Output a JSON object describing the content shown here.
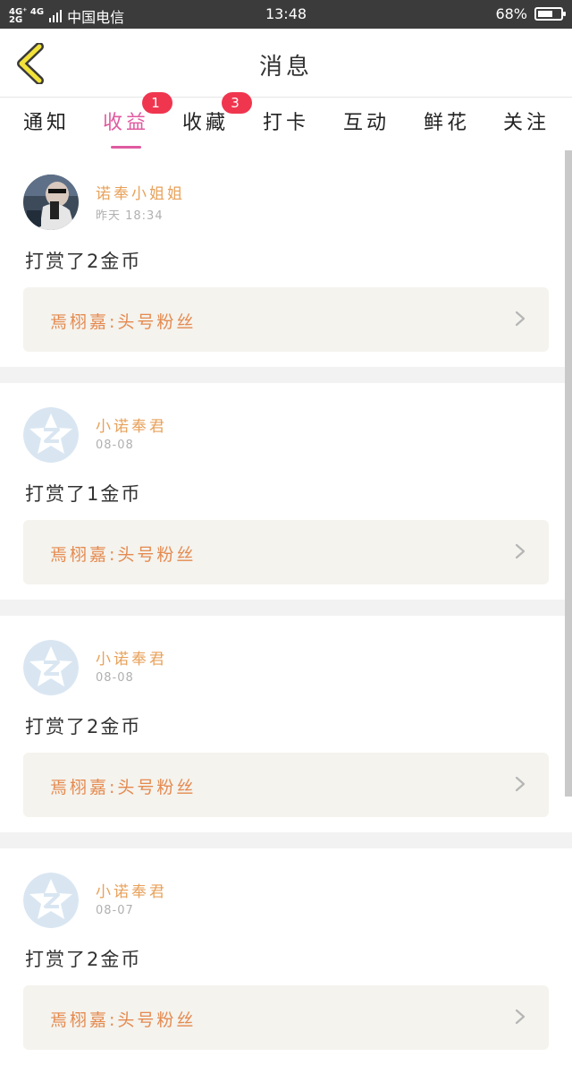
{
  "status_bar": {
    "network_top": "4G⁺ 4G",
    "network_bottom": "2G",
    "carrier": "中国电信",
    "time": "13:48",
    "battery_percent": "68%",
    "battery_level": 0.68
  },
  "header": {
    "back_icon": "chevron-left-icon",
    "title": "消息"
  },
  "tabs": [
    {
      "label": "通知"
    },
    {
      "label": "收益",
      "active": true,
      "badge": "1"
    },
    {
      "label": "收藏",
      "badge": "3"
    },
    {
      "label": "打卡"
    },
    {
      "label": "互动"
    },
    {
      "label": "鲜花"
    },
    {
      "label": "关注"
    }
  ],
  "colors": {
    "accent": "#e05aa0",
    "badge": "#f0364f",
    "name": "#e8a15a",
    "link": "#e58a4f"
  },
  "items": [
    {
      "name": "诺奉小姐姐",
      "time": "昨天 18:34",
      "message": "打赏了2金币",
      "link": "焉栩嘉:头号粉丝",
      "avatar": "photo"
    },
    {
      "name": "小诺奉君",
      "time": "08-08",
      "message": "打赏了1金币",
      "link": "焉栩嘉:头号粉丝",
      "avatar": "default-qq-icon"
    },
    {
      "name": "小诺奉君",
      "time": "08-08",
      "message": "打赏了2金币",
      "link": "焉栩嘉:头号粉丝",
      "avatar": "default-qq-icon"
    },
    {
      "name": "小诺奉君",
      "time": "08-07",
      "message": "打赏了2金币",
      "link": "焉栩嘉:头号粉丝",
      "avatar": "default-qq-icon"
    }
  ]
}
